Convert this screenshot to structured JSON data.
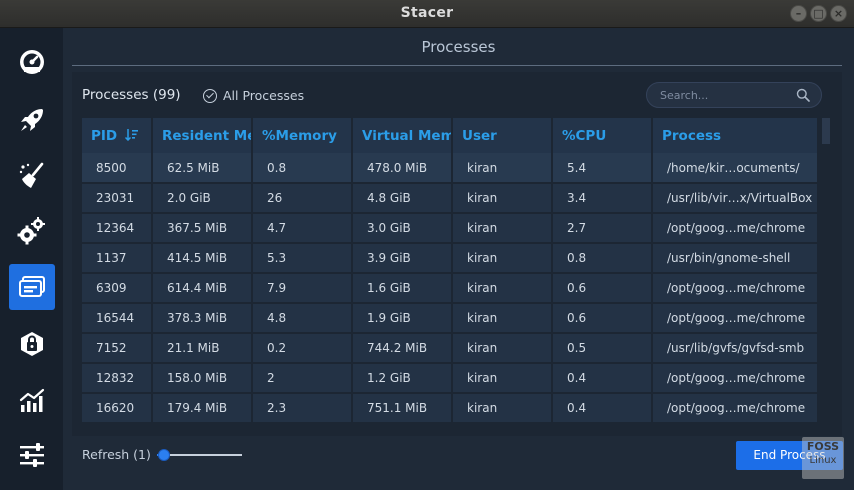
{
  "window": {
    "title": "Stacer"
  },
  "sidebar": {
    "items": [
      {
        "icon": "speedometer-icon",
        "label": "Dashboard"
      },
      {
        "icon": "rocket-icon",
        "label": "Startup Apps"
      },
      {
        "icon": "broom-icon",
        "label": "System Cleaner"
      },
      {
        "icon": "gears-icon",
        "label": "Services"
      },
      {
        "icon": "processes-icon",
        "label": "Processes",
        "active": true
      },
      {
        "icon": "package-lock-icon",
        "label": "Uninstaller"
      },
      {
        "icon": "chart-icon",
        "label": "Resources"
      },
      {
        "icon": "sliders-icon",
        "label": "Settings"
      }
    ]
  },
  "page": {
    "title": "Processes"
  },
  "toolbar": {
    "process_count": "Processes (99)",
    "all_processes_label": "All Processes",
    "search_placeholder": "Search..."
  },
  "table": {
    "columns": [
      "PID",
      "Resident Me",
      "%Memory",
      "Virtual Mem",
      "User",
      "%CPU",
      "Process"
    ],
    "rows": [
      [
        "8500",
        "62.5 MiB",
        "0.8",
        "478.0 MiB",
        "kiran",
        "5.4",
        "/home/kir…ocuments/"
      ],
      [
        "23031",
        "2.0 GiB",
        "26",
        "4.8 GiB",
        "kiran",
        "3.4",
        "/usr/lib/vir…x/VirtualBox"
      ],
      [
        "12364",
        "367.5 MiB",
        "4.7",
        "3.0 GiB",
        "kiran",
        "2.7",
        "/opt/goog…me/chrome"
      ],
      [
        "1137",
        "414.5 MiB",
        "5.3",
        "3.9 GiB",
        "kiran",
        "0.8",
        "/usr/bin/gnome-shell"
      ],
      [
        "6309",
        "614.4 MiB",
        "7.9",
        "1.6 GiB",
        "kiran",
        "0.6",
        "/opt/goog…me/chrome"
      ],
      [
        "16544",
        "378.3 MiB",
        "4.8",
        "1.9 GiB",
        "kiran",
        "0.6",
        "/opt/goog…me/chrome"
      ],
      [
        "7152",
        "21.1 MiB",
        "0.2",
        "744.2 MiB",
        "kiran",
        "0.5",
        "/usr/lib/gvfs/gvfsd-smb"
      ],
      [
        "12832",
        "158.0 MiB",
        "2",
        "1.2 GiB",
        "kiran",
        "0.4",
        "/opt/goog…me/chrome"
      ],
      [
        "16620",
        "179.4 MiB",
        "2.3",
        "751.1 MiB",
        "kiran",
        "0.4",
        "/opt/goog…me/chrome"
      ]
    ]
  },
  "footer": {
    "refresh_label": "Refresh (1)",
    "end_process_label": "End Process"
  },
  "watermark": {
    "line1": "FOSS",
    "line2": "Linux"
  },
  "colors": {
    "accent": "#1c6ee8",
    "header_text": "#2b9de8",
    "background": "#1f2a38",
    "sidebar": "#17202c"
  }
}
